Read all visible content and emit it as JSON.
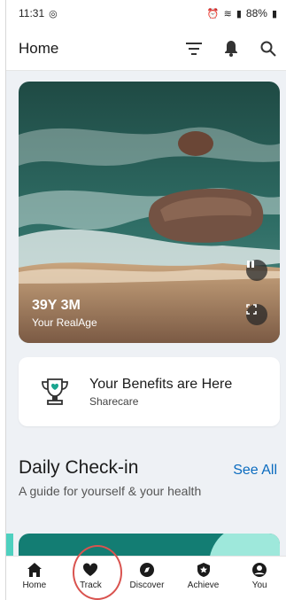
{
  "status_bar": {
    "time": "11:31",
    "battery": "88%"
  },
  "header": {
    "title": "Home"
  },
  "hero": {
    "age": "39Y 3M",
    "age_label": "Your RealAge"
  },
  "benefits": {
    "title": "Your Benefits are Here",
    "subtitle": "Sharecare"
  },
  "checkin": {
    "title": "Daily Check-in",
    "see_all": "See All",
    "subtitle": "A guide for yourself & your health"
  },
  "nav": {
    "items": [
      {
        "label": "Home",
        "icon": "home-icon"
      },
      {
        "label": "Track",
        "icon": "heart-icon"
      },
      {
        "label": "Discover",
        "icon": "compass-icon"
      },
      {
        "label": "Achieve",
        "icon": "shield-star-icon"
      },
      {
        "label": "You",
        "icon": "person-icon"
      }
    ]
  },
  "colors": {
    "accent": "#0a6bbf",
    "teal": "#137d73",
    "highlight": "#d9534f"
  }
}
